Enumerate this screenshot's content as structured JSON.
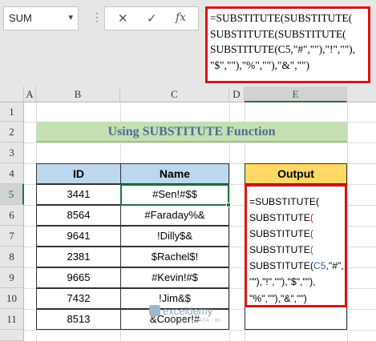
{
  "formula_bar": {
    "name_box": "SUM",
    "cancel_icon": "✕",
    "enter_icon": "✓",
    "fx_label": "fx",
    "formula_lines": [
      "=SUBSTITUTE(SUBSTITUTE(",
      "SUBSTITUTE(SUBSTITUTE(",
      "SUBSTITUTE(C5,\"#\",\"\"),\"!\",\"\"),",
      "\"$\",\"\"),\"%\",\"\"),\"&\",\"\")"
    ]
  },
  "columns": [
    "A",
    "B",
    "C",
    "D",
    "E"
  ],
  "rows": [
    "1",
    "2",
    "3",
    "4",
    "5",
    "6",
    "7",
    "8",
    "9",
    "10",
    "11"
  ],
  "selected_column": "E",
  "selected_row": "5",
  "title": "Using SUBSTITUTE Function",
  "table": {
    "headers": {
      "id": "ID",
      "name": "Name",
      "output": "Output"
    },
    "rows": [
      {
        "id": "3441",
        "name": "#Sen!#$$"
      },
      {
        "id": "8564",
        "name": "#Faraday%&"
      },
      {
        "id": "9641",
        "name": "!Dilly$&"
      },
      {
        "id": "2381",
        "name": "$Rachel$!"
      },
      {
        "id": "9665",
        "name": "#Kevin!#$"
      },
      {
        "id": "7432",
        "name": "!Jim&$"
      },
      {
        "id": "8513",
        "name": "&Cooper!#"
      }
    ]
  },
  "output_formula": {
    "line1": "=SUBSTITUTE(",
    "line2a": "SUBSTITUTE",
    "line2b": "(",
    "line3a": "SUBSTITUTE",
    "line3b": "(",
    "line4a": "SUBSTITUTE",
    "line4b": "(",
    "line5a": "SUBSTITUTE(",
    "line5b": "C5",
    "line5c": ",\"#\",",
    "line6": "\"\"),\"!\",\"\"),\"$\",\"\"),",
    "line7": "\"%\",\"\"),\"&\",\"\")"
  },
  "watermark": {
    "name": "exceldemy",
    "sub": "EXCEL · DATA · BI"
  },
  "colors": {
    "accent_red": "#e01010",
    "excel_green": "#217346",
    "title_bg": "#c5dfb3",
    "header_bg": "#bdd7ee",
    "output_bg": "#ffd966"
  }
}
